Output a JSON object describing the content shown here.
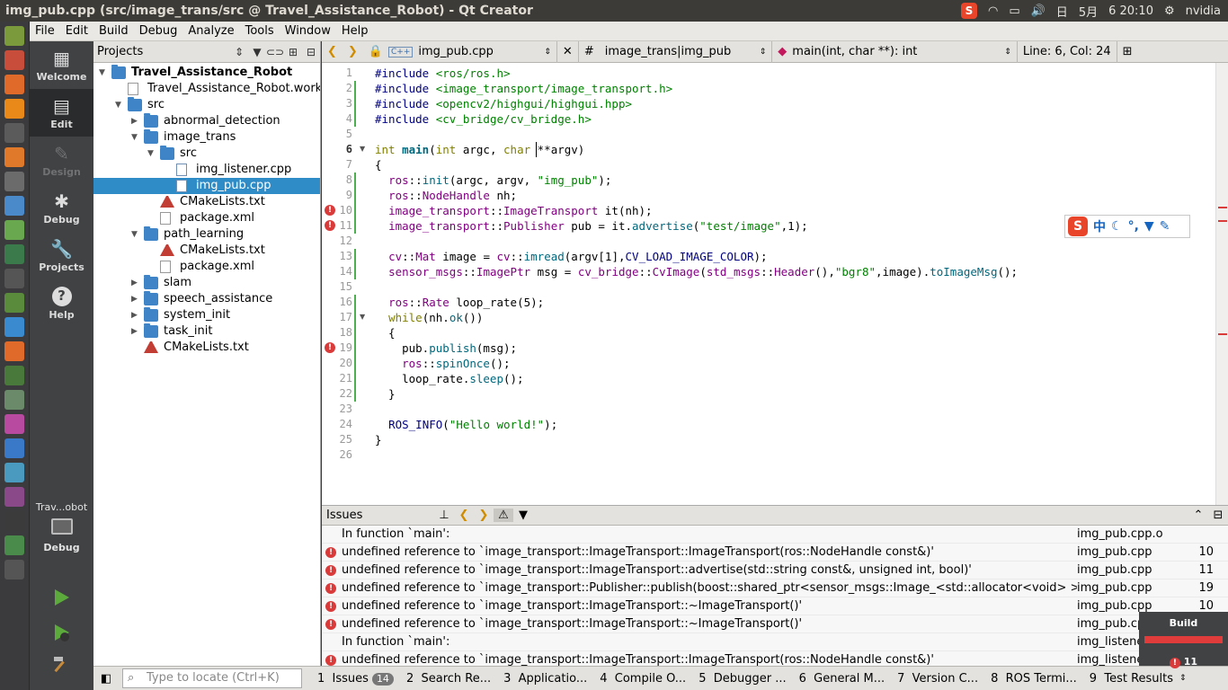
{
  "window": {
    "title": "img_pub.cpp (src/image_trans/src @ Travel_Assistance_Robot) - Qt Creator"
  },
  "tray": {
    "month": "5月",
    "time": "6 20:10",
    "user": "nvidia"
  },
  "menu": [
    "File",
    "Edit",
    "Build",
    "Debug",
    "Analyze",
    "Tools",
    "Window",
    "Help"
  ],
  "modes": [
    {
      "label": "Welcome",
      "icon": "grid-icon"
    },
    {
      "label": "Edit",
      "icon": "edit-icon"
    },
    {
      "label": "Design",
      "icon": "pen-icon"
    },
    {
      "label": "Debug",
      "icon": "bug-icon"
    },
    {
      "label": "Projects",
      "icon": "wrench-icon"
    },
    {
      "label": "Help",
      "icon": "help-icon"
    }
  ],
  "kit": {
    "name": "Trav...obot",
    "mode": "Debug"
  },
  "projects": {
    "header": "Projects",
    "tree": [
      {
        "label": "Travel_Assistance_Robot",
        "depth": 0,
        "type": "root",
        "arrow": "down"
      },
      {
        "label": "Travel_Assistance_Robot.workspace",
        "depth": 1,
        "type": "file",
        "arrow": ""
      },
      {
        "label": "src",
        "depth": 1,
        "type": "folder",
        "arrow": "down"
      },
      {
        "label": "abnormal_detection",
        "depth": 2,
        "type": "folder",
        "arrow": "right"
      },
      {
        "label": "image_trans",
        "depth": 2,
        "type": "folder",
        "arrow": "down"
      },
      {
        "label": "src",
        "depth": 3,
        "type": "folder",
        "arrow": "down"
      },
      {
        "label": "img_listener.cpp",
        "depth": 4,
        "type": "cpp",
        "arrow": ""
      },
      {
        "label": "img_pub.cpp",
        "depth": 4,
        "type": "cpp",
        "arrow": "",
        "selected": true
      },
      {
        "label": "CMakeLists.txt",
        "depth": 3,
        "type": "cmake",
        "arrow": ""
      },
      {
        "label": "package.xml",
        "depth": 3,
        "type": "file",
        "arrow": ""
      },
      {
        "label": "path_learning",
        "depth": 2,
        "type": "folder",
        "arrow": "down"
      },
      {
        "label": "CMakeLists.txt",
        "depth": 3,
        "type": "cmake",
        "arrow": ""
      },
      {
        "label": "package.xml",
        "depth": 3,
        "type": "file",
        "arrow": ""
      },
      {
        "label": "slam",
        "depth": 2,
        "type": "folder",
        "arrow": "right"
      },
      {
        "label": "speech_assistance",
        "depth": 2,
        "type": "folder",
        "arrow": "right"
      },
      {
        "label": "system_init",
        "depth": 2,
        "type": "folder",
        "arrow": "right"
      },
      {
        "label": "task_init",
        "depth": 2,
        "type": "folder",
        "arrow": "right"
      },
      {
        "label": "CMakeLists.txt",
        "depth": 2,
        "type": "cmake",
        "arrow": ""
      }
    ]
  },
  "editor": {
    "file": "img_pub.cpp",
    "symbol_scope": "image_trans|img_pub",
    "function": "main(int, char **): int",
    "position": "Line: 6, Col: 24",
    "current_line": 6,
    "error_lines": [
      10,
      11,
      19
    ],
    "fold_lines": [
      6,
      17
    ],
    "lines": [
      "#include <ros/ros.h>",
      "#include <image_transport/image_transport.h>",
      "#include <opencv2/highgui/highgui.hpp>",
      "#include <cv_bridge/cv_bridge.h>",
      "",
      "int main(int argc, char **argv)",
      "{",
      "  ros::init(argc, argv, \"img_pub\");",
      "  ros::NodeHandle nh;",
      "  image_transport::ImageTransport it(nh);",
      "  image_transport::Publisher pub = it.advertise(\"test/image\",1);",
      "",
      "  cv::Mat image = cv::imread(argv[1],CV_LOAD_IMAGE_COLOR);",
      "  sensor_msgs::ImagePtr msg = cv_bridge::CvImage(std_msgs::Header(),\"bgr8\",image).toImageMsg();",
      "",
      "  ros::Rate loop_rate(5);",
      "  while(nh.ok())",
      "  {",
      "    pub.publish(msg);",
      "    ros::spinOnce();",
      "    loop_rate.sleep();",
      "  }",
      "",
      "  ROS_INFO(\"Hello world!\");",
      "}",
      ""
    ]
  },
  "ime": {
    "chinese": "中",
    "moon": "☾",
    "comma": "°,",
    "shirt": "👕",
    "wrench": "🔧"
  },
  "issues": {
    "header": "Issues",
    "rows": [
      {
        "error": false,
        "message": "In function `main':",
        "file": "img_pub.cpp.o",
        "line": ""
      },
      {
        "error": true,
        "message": "undefined reference to `image_transport::ImageTransport::ImageTransport(ros::NodeHandle const&)'",
        "file": "img_pub.cpp",
        "line": "10"
      },
      {
        "error": true,
        "message": "undefined reference to `image_transport::ImageTransport::advertise(std::string const&, unsigned int, bool)'",
        "file": "img_pub.cpp",
        "line": "11"
      },
      {
        "error": true,
        "message": "undefined reference to `image_transport::Publisher::publish(boost::shared_ptr<sensor_msgs::Image_<std::allocator<void> > const> const&) const'",
        "file": "img_pub.cpp",
        "line": "19"
      },
      {
        "error": true,
        "message": "undefined reference to `image_transport::ImageTransport::~ImageTransport()'",
        "file": "img_pub.cpp",
        "line": "10"
      },
      {
        "error": true,
        "message": "undefined reference to `image_transport::ImageTransport::~ImageTransport()'",
        "file": "img_pub.cpp",
        "line": ""
      },
      {
        "error": false,
        "message": "In function `main':",
        "file": "img_listener.cpp.o",
        "line": ""
      },
      {
        "error": true,
        "message": "undefined reference to `image_transport::ImageTransport::ImageTransport(ros::NodeHandle const&)'",
        "file": "img_listener.cpp",
        "line": ""
      }
    ]
  },
  "locator": {
    "placeholder": "Type to locate (Ctrl+K)"
  },
  "output_tabs": [
    {
      "label": "1  Issues",
      "badge": "14"
    },
    {
      "label": "2  Search Re..."
    },
    {
      "label": "3  Applicatio..."
    },
    {
      "label": "4  Compile O..."
    },
    {
      "label": "5  Debugger ..."
    },
    {
      "label": "6  General M..."
    },
    {
      "label": "7  Version C..."
    },
    {
      "label": "8  ROS Termi..."
    },
    {
      "label": "9  Test Results"
    }
  ],
  "build": {
    "label": "Build",
    "errors": "11",
    "progress": 1.0,
    "status_color": "#e03c3c"
  }
}
